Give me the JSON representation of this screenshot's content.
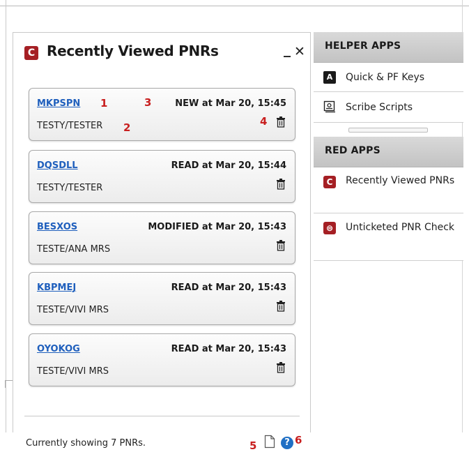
{
  "panel": {
    "title": "Recently Viewed PNRs",
    "minimize": "_",
    "close": "✕",
    "logo_letter": "C",
    "accent_color": "#a51f24",
    "records": [
      {
        "pnr": "MKPSPN",
        "status": "NEW at Mar 20, 15:45",
        "pax": "TESTY/TESTER"
      },
      {
        "pnr": "DQSDLL",
        "status": "READ at Mar 20, 15:44",
        "pax": "TESTY/TESTER"
      },
      {
        "pnr": "BESXOS",
        "status": "MODIFIED at Mar 20, 15:43",
        "pax": "TESTE/ANA MRS"
      },
      {
        "pnr": "KBPMEJ",
        "status": "READ at Mar 20, 15:43",
        "pax": "TESTE/VIVI MRS"
      },
      {
        "pnr": "OYOKOG",
        "status": "READ at Mar 20, 15:43",
        "pax": "TESTE/VIVI MRS"
      }
    ],
    "footer_text": "Currently showing 7 PNRs.",
    "help_label": "?"
  },
  "annotations": {
    "n1": "1",
    "n2": "2",
    "n3": "3",
    "n4": "4",
    "n5": "5",
    "n6": "6"
  },
  "sidebar": {
    "helper_title": "HELPER APPS",
    "helper_items": [
      {
        "label": "Quick & PF Keys",
        "icon": "a-key-icon",
        "icon_letter": "A"
      },
      {
        "label": "Scribe Scripts",
        "icon": "scribe-icon"
      }
    ],
    "red_title": "RED APPS",
    "red_items": [
      {
        "label": "Recently Viewed PNRs",
        "icon": "red-logo-icon",
        "icon_letter": "C"
      },
      {
        "label": "Unticketed PNR Check",
        "icon": "red-check-icon",
        "icon_letter": "⊜"
      }
    ]
  }
}
